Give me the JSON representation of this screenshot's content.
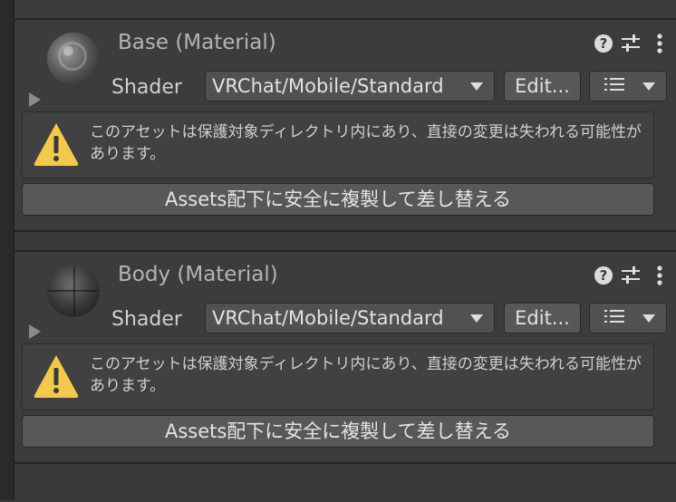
{
  "materials": [
    {
      "title": "Base (Material)",
      "preview": "base-material-preview",
      "shader_label": "Shader",
      "shader_value": "VRChat/Mobile/Standard",
      "edit_label": "Edit...",
      "warning_text": "このアセットは保護対象ディレクトリ内にあり、直接の変更は失われる可能性があります。",
      "action_label": "Assets配下に安全に複製して差し替える"
    },
    {
      "title": "Body (Material)",
      "preview": "body-material-preview",
      "shader_label": "Shader",
      "shader_value": "VRChat/Mobile/Standard",
      "edit_label": "Edit...",
      "warning_text": "このアセットは保護対象ディレクトリ内にあり、直接の変更は失われる可能性があります。",
      "action_label": "Assets配下に安全に複製して差し替える"
    }
  ],
  "icons": {
    "help": "help-icon",
    "presets": "preset-sliders-icon",
    "more": "more-vertical-icon",
    "warning": "warning-icon",
    "list": "list-icon"
  },
  "colors": {
    "background": "#383838",
    "panel": "#3c3c3c",
    "warning": "#f2c94c"
  }
}
